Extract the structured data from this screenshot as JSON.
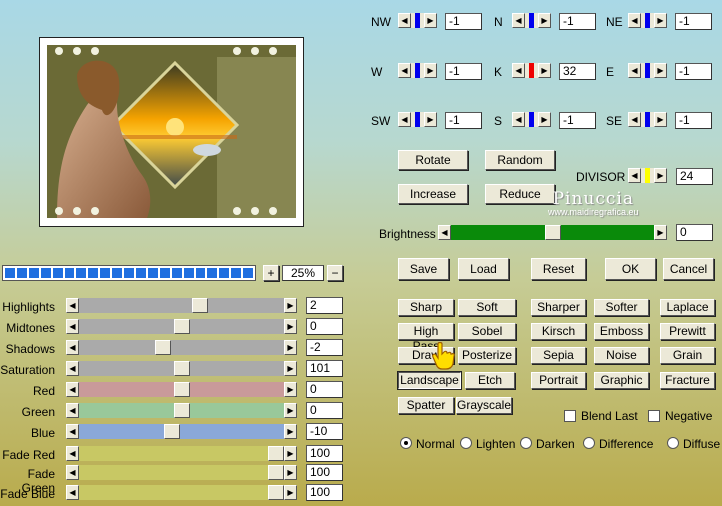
{
  "matrix": [
    {
      "id": "nw",
      "label": "NW",
      "value": "-1",
      "color": "#0000ee"
    },
    {
      "id": "n",
      "label": "N",
      "value": "-1",
      "color": "#0000ee"
    },
    {
      "id": "ne",
      "label": "NE",
      "value": "-1",
      "color": "#0000ee"
    },
    {
      "id": "w",
      "label": "W",
      "value": "-1",
      "color": "#0000ee"
    },
    {
      "id": "k",
      "label": "K",
      "value": "32",
      "color": "#ee0000"
    },
    {
      "id": "e",
      "label": "E",
      "value": "-1",
      "color": "#0000ee"
    },
    {
      "id": "sw",
      "label": "SW",
      "value": "-1",
      "color": "#0000ee"
    },
    {
      "id": "s",
      "label": "S",
      "value": "-1",
      "color": "#0000ee"
    },
    {
      "id": "se",
      "label": "SE",
      "value": "-1",
      "color": "#0000ee"
    }
  ],
  "buttons": {
    "rotate": "Rotate",
    "random": "Random",
    "increase": "Increase",
    "reduce": "Reduce",
    "save": "Save",
    "load": "Load",
    "reset": "Reset",
    "ok": "OK",
    "cancel": "Cancel"
  },
  "divisor": {
    "label": "DIVISOR",
    "value": "24",
    "color": "#ffff00"
  },
  "watermark": {
    "line1": "Pinuccia",
    "line2": "www.maidiregrafica.eu"
  },
  "brightness": {
    "label": "Brightness",
    "value": "0",
    "level": 0.5
  },
  "zoom": {
    "plus": "+",
    "minus": "−",
    "value": "25%"
  },
  "sliders": [
    {
      "label": "Highlights",
      "value": "2",
      "level": 0.6,
      "color": "#aaaaaa"
    },
    {
      "label": "Midtones",
      "value": "0",
      "level": 0.5,
      "color": "#aaaaaa"
    },
    {
      "label": "Shadows",
      "value": "-2",
      "level": 0.4,
      "color": "#aaaaaa"
    },
    {
      "label": "Saturation",
      "value": "101",
      "level": 0.5,
      "color": "#aaaaaa"
    },
    {
      "label": "Red",
      "value": "0",
      "level": 0.5,
      "color": "#c99a9a"
    },
    {
      "label": "Green",
      "value": "0",
      "level": 0.5,
      "color": "#99c89a"
    },
    {
      "label": "Blue",
      "value": "-10",
      "level": 0.45,
      "color": "#8aa8d8"
    },
    {
      "label": "Fade Red",
      "value": "100",
      "level": 1.0,
      "color": "#c8c864"
    },
    {
      "label": "Fade Green",
      "value": "100",
      "level": 1.0,
      "color": "#c8c864"
    },
    {
      "label": "Fade Blue",
      "value": "100",
      "level": 1.0,
      "color": "#c8c864"
    }
  ],
  "presets": [
    [
      "Sharp",
      "Soft",
      "Sharper",
      "Softer",
      "Laplace"
    ],
    [
      "High Pass",
      "Sobel",
      "Kirsch",
      "Emboss",
      "Prewitt"
    ],
    [
      "Draw",
      "Posterize",
      "Sepia",
      "Noise",
      "Grain"
    ],
    [
      "Landscape",
      "Etch",
      "Portrait",
      "Graphic",
      "Fracture"
    ],
    [
      "Spatter",
      "Grayscale"
    ]
  ],
  "checkboxes": {
    "blend_last": "Blend Last",
    "negative": "Negative"
  },
  "blend_modes": [
    {
      "label": "Normal",
      "selected": true
    },
    {
      "label": "Lighten",
      "selected": false
    },
    {
      "label": "Darken",
      "selected": false
    },
    {
      "label": "Difference",
      "selected": false
    },
    {
      "label": "Diffuse",
      "selected": false
    }
  ]
}
